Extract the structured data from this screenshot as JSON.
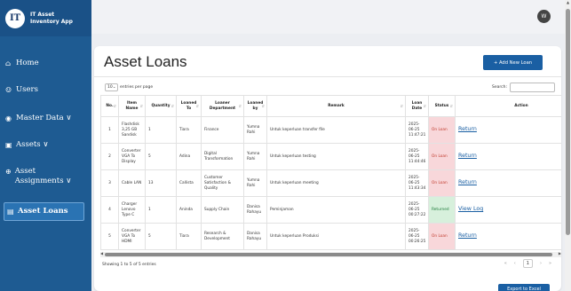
{
  "app": {
    "logo_text": "IT",
    "logo_sub": "LOGO",
    "name_line1": "IT Asset",
    "name_line2": "Inventory App"
  },
  "sidebar": {
    "items": [
      {
        "label": "Home",
        "icon": "home-icon"
      },
      {
        "label": "Users",
        "icon": "users-icon"
      },
      {
        "label": "Master Data ∨",
        "icon": "database-icon"
      },
      {
        "label": "Assets ∨",
        "icon": "assets-icon"
      },
      {
        "label": "Asset Assignments ∨",
        "icon": "assignment-icon"
      },
      {
        "label": "Asset Loans",
        "icon": "loans-icon"
      }
    ]
  },
  "topbar": {
    "avatar_initial": "W"
  },
  "page": {
    "title": "Asset Loans",
    "add_button": "+ Add New Loan",
    "length_value": "10",
    "length_suffix": "entries per page",
    "search_label": "Search:",
    "search_value": "",
    "info": "Showing 1 to 5 of 5 entries",
    "pager_prev2": "«",
    "pager_prev": "‹",
    "pager_current": "1",
    "pager_next": "›",
    "pager_next2": "»",
    "export_button": "Export to Excel"
  },
  "table": {
    "columns": [
      "No.",
      "Item Name",
      "Quantity",
      "Loaned To",
      "Loaner Department",
      "Loaned by",
      "Remark",
      "Loan Date",
      "Status",
      "Action"
    ],
    "rows": [
      {
        "no": "1",
        "item": "Flashdisk 3,25 GB Sandisk",
        "qty": "1",
        "to": "Tiara",
        "dept": "Finance",
        "by": "Yumna Rahi",
        "remark": "Untuk keperluan transfer file",
        "date": "2025-06-25 11:47:21",
        "status": "On Loan",
        "action": "Return"
      },
      {
        "no": "2",
        "item": "Converter VGA To Display",
        "qty": "5",
        "to": "Adina",
        "dept": "Digital Transformation",
        "by": "Yumna Rahi",
        "remark": "Untuk keperluan testing",
        "date": "2025-06-25 11:44:46",
        "status": "On Loan",
        "action": "Return"
      },
      {
        "no": "3",
        "item": "Cable LAN",
        "qty": "13",
        "to": "Callista",
        "dept": "Customer Satisfaction & Quality",
        "by": "Yumna Rahi",
        "remark": "Untuk keperluan meeting",
        "date": "2025-06-25 11:43:34",
        "status": "On Loan",
        "action": "Return"
      },
      {
        "no": "4",
        "item": "Charger Lenovo Type C",
        "qty": "1",
        "to": "Aninda",
        "dept": "Supply Chain",
        "by": "Danisa Rahayu",
        "remark": "Peminjaman",
        "date": "2025-06-25 00:27:22",
        "status": "Returned",
        "action": "View Log"
      },
      {
        "no": "5",
        "item": "Converter VGA To HDMI",
        "qty": "5",
        "to": "Tiara",
        "dept": "Research & Development",
        "by": "Danisa Rahayu",
        "remark": "Untuk keperluan Produksi",
        "date": "2025-06-25 00:26:25",
        "status": "On Loan",
        "action": "Return"
      }
    ]
  },
  "colors": {
    "sidebar": "#1e5b92",
    "accent": "#1a5fa3",
    "on_loan_bg": "#f8d7da",
    "returned_bg": "#d7f0dc"
  }
}
